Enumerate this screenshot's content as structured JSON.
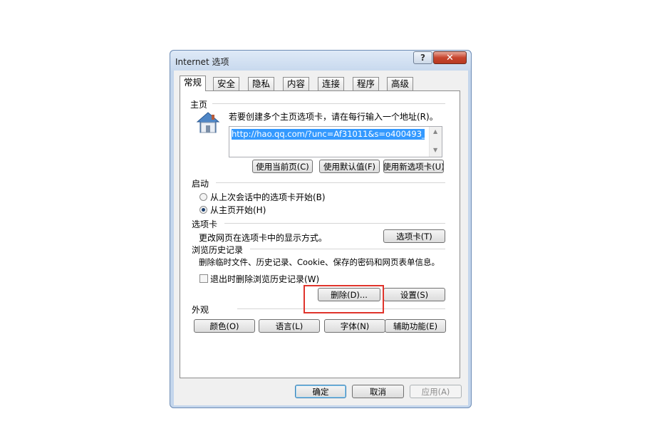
{
  "dialog": {
    "title": "Internet 选项",
    "help_glyph": "?",
    "close_glyph": "✕"
  },
  "tabs": [
    {
      "label": "常规",
      "active": true
    },
    {
      "label": "安全"
    },
    {
      "label": "隐私"
    },
    {
      "label": "内容"
    },
    {
      "label": "连接"
    },
    {
      "label": "程序"
    },
    {
      "label": "高级"
    }
  ],
  "homepage": {
    "heading": "主页",
    "description": "若要创建多个主页选项卡，请在每行输入一个地址(R)。",
    "address": "http://hao.qq.com/?unc=Af31011&s=o400493_",
    "icon": "house-icon",
    "buttons": {
      "use_current": "使用当前页(C)",
      "use_default": "使用默认值(F)",
      "use_new_tab": "使用新选项卡(U)"
    }
  },
  "startup": {
    "heading": "启动",
    "options": [
      {
        "label": "从上次会话中的选项卡开始(B)",
        "selected": false
      },
      {
        "label": "从主页开始(H)",
        "selected": true
      }
    ]
  },
  "tabs_section": {
    "heading": "选项卡",
    "description": "更改网页在选项卡中的显示方式。",
    "button": "选项卡(T)"
  },
  "history": {
    "heading": "浏览历史记录",
    "description": "删除临时文件、历史记录、Cookie、保存的密码和网页表单信息。",
    "checkbox_label": "退出时删除浏览历史记录(W)",
    "checkbox_checked": false,
    "delete_button": "删除(D)...",
    "settings_button": "设置(S)"
  },
  "appearance": {
    "heading": "外观",
    "buttons": {
      "colors": "颜色(O)",
      "languages": "语言(L)",
      "fonts": "字体(N)",
      "accessibility": "辅助功能(E)"
    }
  },
  "footer": {
    "ok": "确定",
    "cancel": "取消",
    "apply": "应用(A)"
  },
  "colors": {
    "highlight": "#3399ff",
    "annotation": "#e0342b"
  }
}
